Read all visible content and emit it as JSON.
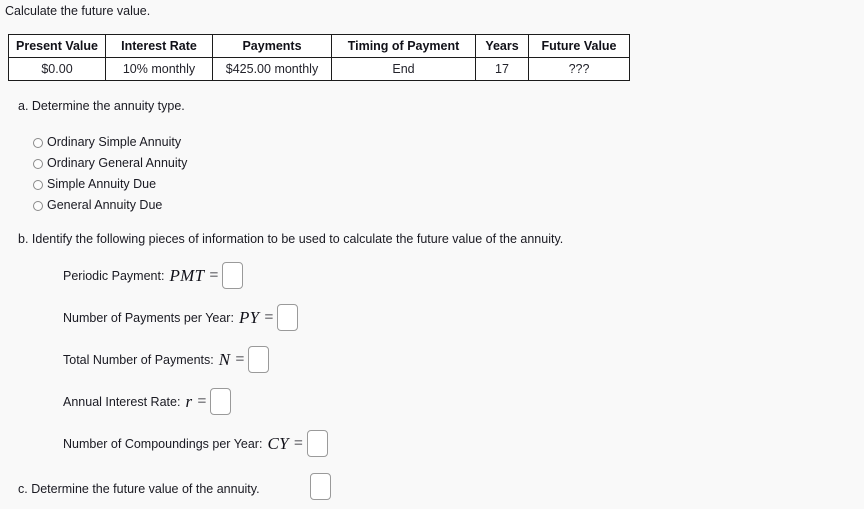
{
  "intro": {
    "text": "Calculate the future value."
  },
  "table": {
    "headers": [
      "Present Value",
      "Interest Rate",
      "Payments",
      "Timing of Payment",
      "Years",
      "Future Value"
    ],
    "row": [
      "$0.00",
      "10% monthly",
      "$425.00 monthly",
      "End",
      "17",
      "???"
    ]
  },
  "parts": {
    "a": {
      "prompt": "a. Determine the annuity type.",
      "options": [
        {
          "label": "Ordinary Simple Annuity",
          "selected": false
        },
        {
          "label": "Ordinary General Annuity",
          "selected": false
        },
        {
          "label": "Simple Annuity Due",
          "selected": false
        },
        {
          "label": "General Annuity Due",
          "selected": false
        }
      ]
    },
    "b": {
      "prompt": "b. Identify the following pieces of information to be used to calculate the future value of the annuity.",
      "fields": [
        {
          "label": "Periodic Payment:",
          "symbol": "PMT",
          "equals": "=",
          "value": ""
        },
        {
          "label": "Number of Payments per Year:",
          "symbol": "PY",
          "equals": "=",
          "value": ""
        },
        {
          "label": "Total Number of Payments:",
          "symbol": "N",
          "equals": "=",
          "value": ""
        },
        {
          "label": "Annual Interest Rate:",
          "symbol": "r",
          "equals": "=",
          "value": ""
        },
        {
          "label": "Number of Compoundings per Year:",
          "symbol": "CY",
          "equals": "=",
          "value": ""
        }
      ]
    },
    "c": {
      "prompt": "c. Determine the future value of the annuity.",
      "value": ""
    }
  },
  "colors": {
    "background": "#f9f9f9",
    "text": "#1a1a22",
    "table_border": "#1c1c1c",
    "field_border": "#9a9a9a",
    "radio_border": "#8a8a8a"
  }
}
